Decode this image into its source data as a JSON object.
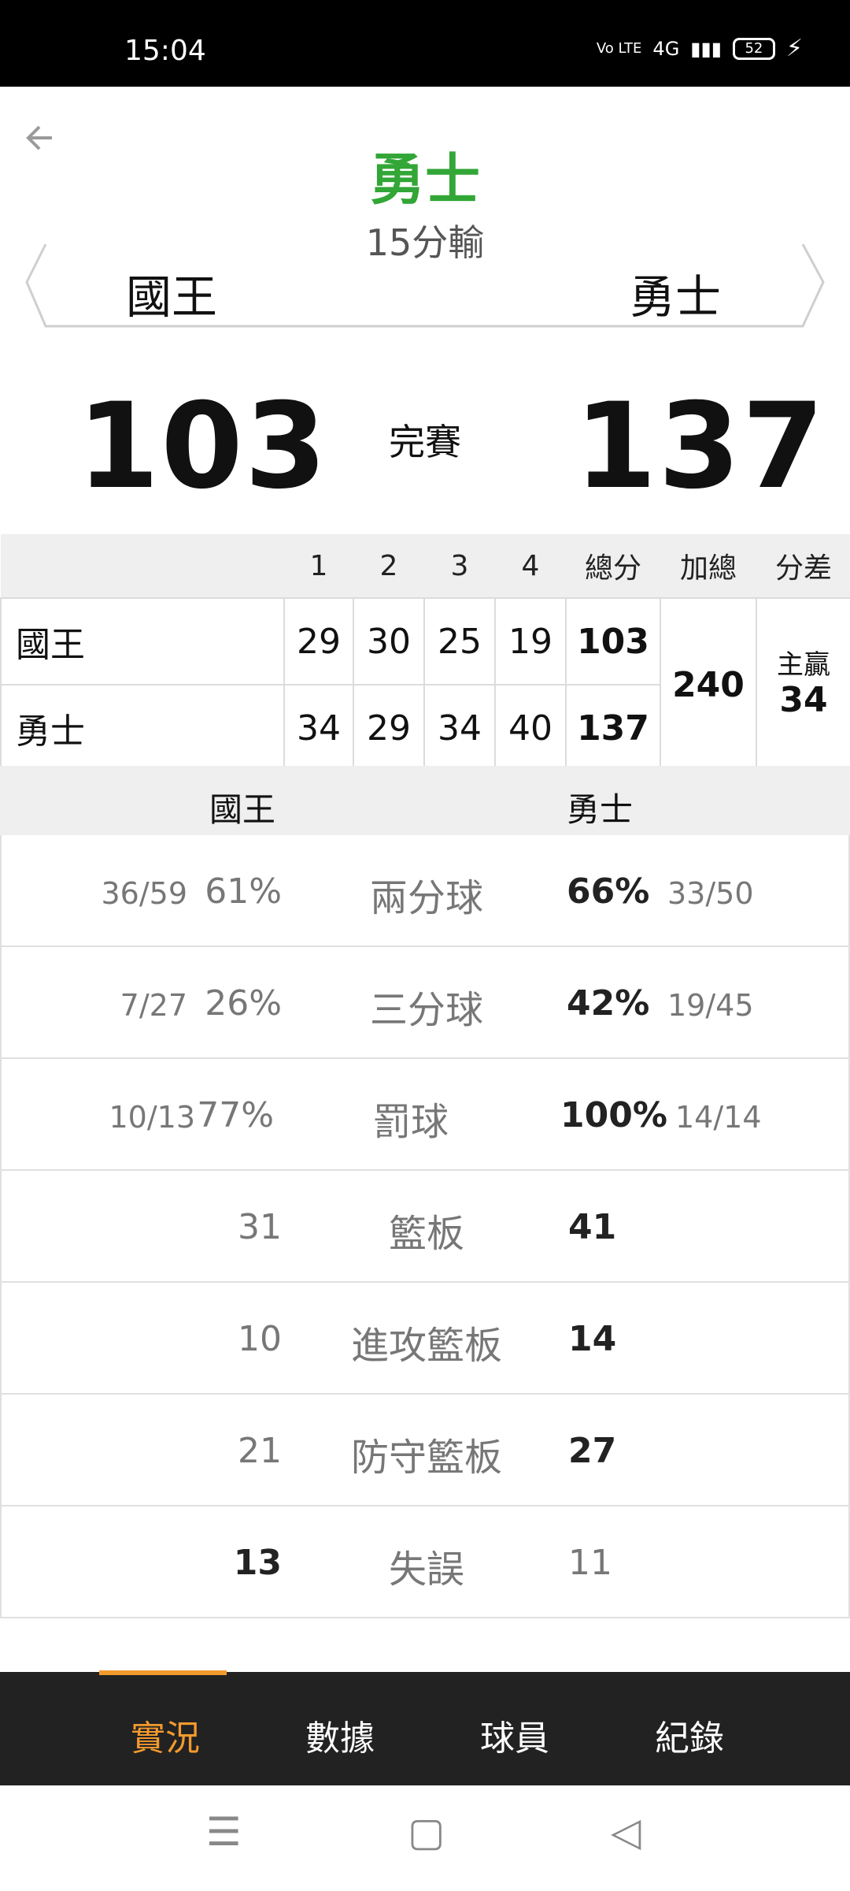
{
  "status_bar": {
    "time": "15:04",
    "network": "4G",
    "volte": "Vo LTE",
    "battery": "52"
  },
  "header": {
    "winner": "勇士",
    "margin_text": "15分輸",
    "team_left": "國王",
    "team_right": "勇士"
  },
  "score": {
    "left": "103",
    "right": "137",
    "status": "完賽"
  },
  "quarters": {
    "headers": [
      "1",
      "2",
      "3",
      "4",
      "總分",
      "加總",
      "分差"
    ],
    "rows": [
      {
        "team": "國王",
        "q": [
          "29",
          "30",
          "25",
          "19"
        ],
        "total": "103"
      },
      {
        "team": "勇士",
        "q": [
          "34",
          "29",
          "34",
          "40"
        ],
        "total": "137"
      }
    ],
    "sum": "240",
    "diff_label": "主贏",
    "diff_value": "34"
  },
  "stats_header": {
    "left": "國王",
    "right": "勇士"
  },
  "stats": [
    {
      "label": "兩分球",
      "lfrac": "36/59",
      "lpct": "61%",
      "rpct": "66%",
      "rfrac": "33/50"
    },
    {
      "label": "三分球",
      "lfrac": "7/27",
      "lpct": "26%",
      "rpct": "42%",
      "rfrac": "19/45"
    },
    {
      "label": "罰球",
      "lfrac": "10/13",
      "lpct": "77%",
      "rpct": "100%",
      "rfrac": "14/14"
    },
    {
      "label": "籃板",
      "lval": "31",
      "rval": "41"
    },
    {
      "label": "進攻籃板",
      "lval": "10",
      "rval": "14"
    },
    {
      "label": "防守籃板",
      "lval": "21",
      "rval": "27"
    },
    {
      "label": "失誤",
      "lval": "13",
      "rval": "11"
    }
  ],
  "tabs": [
    "實況",
    "數據",
    "球員",
    "紀錄"
  ],
  "colors": {
    "winner": "#32a636",
    "accent": "#f29a2e",
    "tabbar": "#222222"
  },
  "icons": {
    "back": "arrow-left-icon",
    "menu": "menu-icon",
    "home": "home-square-icon",
    "sys_back": "triangle-back-icon"
  }
}
